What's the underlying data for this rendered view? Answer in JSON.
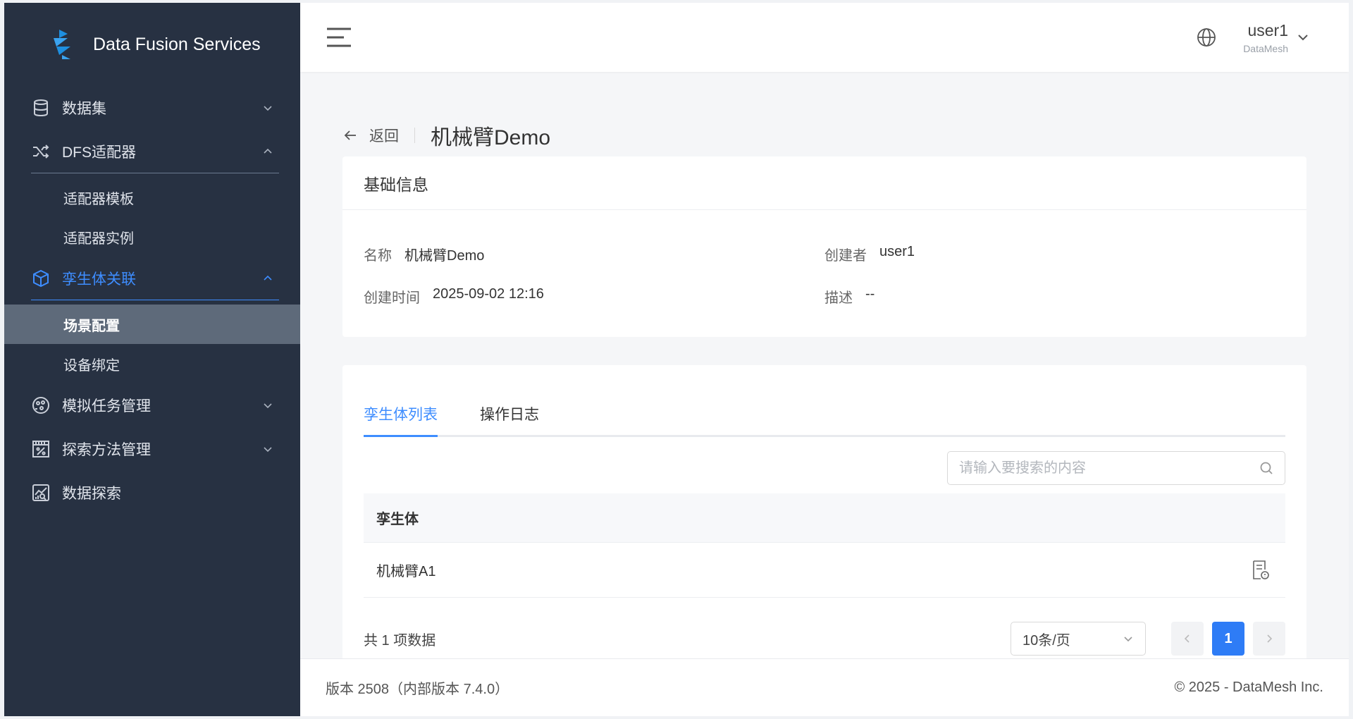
{
  "brand": {
    "name": "Data Fusion Services"
  },
  "sidebar": {
    "items": [
      {
        "label": "数据集",
        "icon": "database-icon"
      },
      {
        "label": "DFS适配器",
        "icon": "shuffle-icon"
      },
      {
        "label": "适配器模板"
      },
      {
        "label": "适配器实例"
      },
      {
        "label": "孪生体关联",
        "icon": "cube-icon"
      },
      {
        "label": "场景配置"
      },
      {
        "label": "设备绑定"
      },
      {
        "label": "模拟任务管理",
        "icon": "simulation-icon"
      },
      {
        "label": "探索方法管理",
        "icon": "percent-calendar-icon"
      },
      {
        "label": "数据探索",
        "icon": "chart-search-icon"
      }
    ]
  },
  "header": {
    "user_name": "user1",
    "user_org": "DataMesh"
  },
  "page": {
    "back_label": "返回",
    "title": "机械臂Demo"
  },
  "info": {
    "card_title": "基础信息",
    "name_key": "名称",
    "name_value": "机械臂Demo",
    "creator_key": "创建者",
    "creator_value": "user1",
    "created_key": "创建时间",
    "created_value": "2025-09-02 12:16",
    "desc_key": "描述",
    "desc_value": "--"
  },
  "list": {
    "tabs": [
      "孪生体列表",
      "操作日志"
    ],
    "search_placeholder": "请输入要搜索的内容",
    "column": "孪生体",
    "rows": [
      "机械臂A1"
    ],
    "total": "共 1 项数据",
    "page_size": "10条/页",
    "current_page": "1"
  },
  "footer": {
    "version": "版本 2508（内部版本 7.4.0）",
    "copyright": "© 2025 - DataMesh Inc."
  },
  "colors": {
    "sidebar_bg": "#273142",
    "accent": "#3e8dff",
    "selected_item_bg": "#5e6a7a",
    "pager_current": "#2e7cf6"
  }
}
